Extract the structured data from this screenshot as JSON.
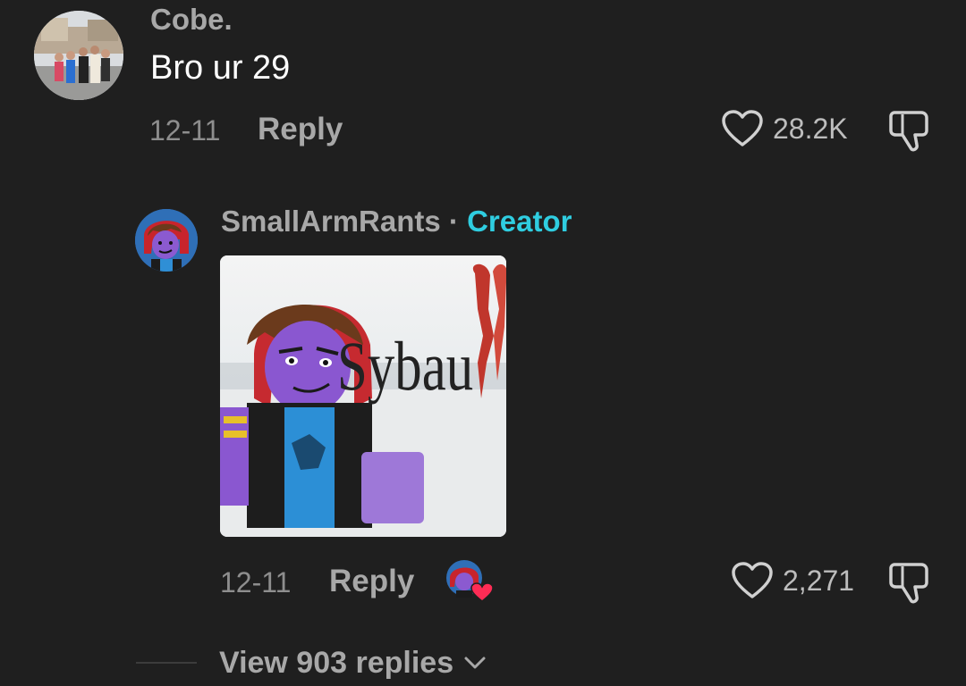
{
  "comments": [
    {
      "username": "Cobe.",
      "text": "Bro ur 29",
      "date": "12-11",
      "reply_label": "Reply",
      "like_count": "28.2K",
      "avatar_icon": "group-photo-avatar"
    },
    {
      "username": "SmallArmRants",
      "separator": "·",
      "badge": "Creator",
      "date": "12-11",
      "reply_label": "Reply",
      "like_count": "2,271",
      "avatar_icon": "cartoon-character-avatar",
      "sticker": {
        "caption": "Sybau",
        "icon": "broken-heart-icon"
      },
      "creator_liked": true
    }
  ],
  "view_replies": {
    "label": "View 903 replies",
    "icon": "chevron-down-icon"
  },
  "colors": {
    "background": "#1f1f1f",
    "username": "#a8a8a8",
    "creator_badge": "#2fcde0",
    "heart_badge": "#fe2c55"
  }
}
